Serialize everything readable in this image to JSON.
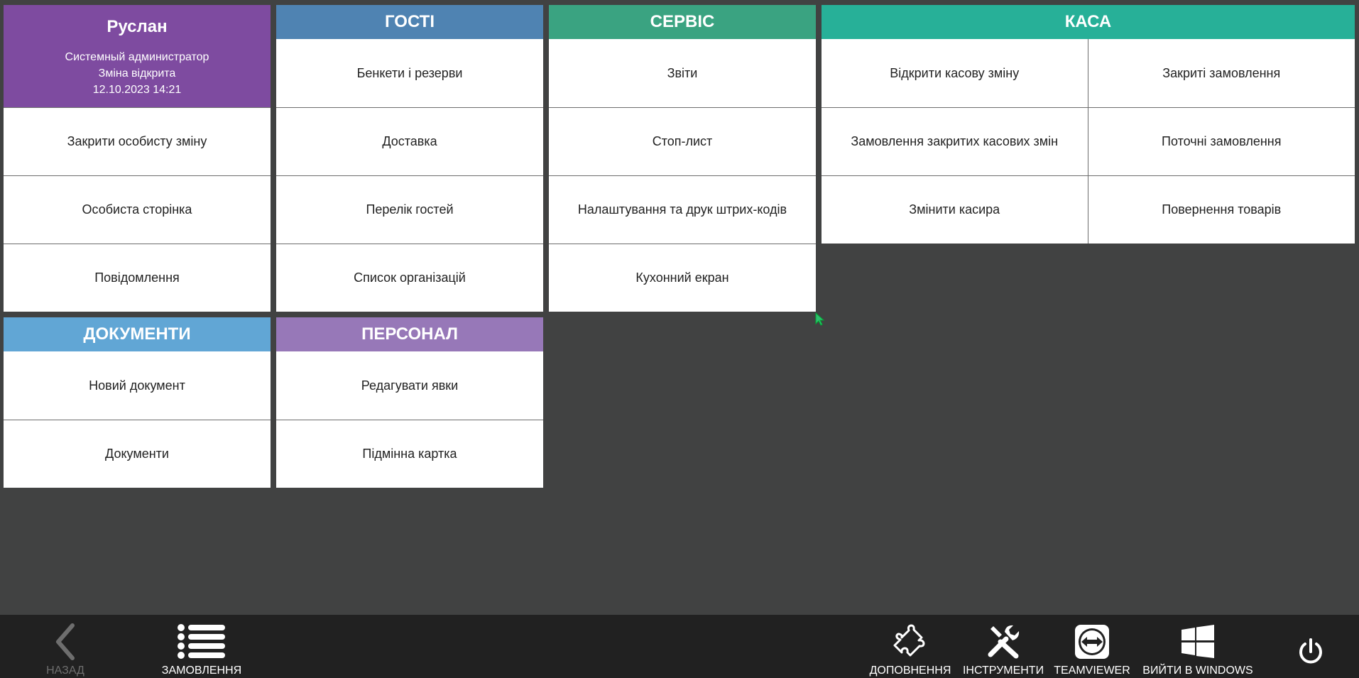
{
  "colors": {
    "background": "#414242",
    "user": "#7e4ba0",
    "guests": "#4f83b2",
    "service": "#3aa381",
    "cash": "#27b098",
    "documents": "#61a6d5",
    "staff": "#9778b8",
    "toolbar": "#212121"
  },
  "user": {
    "name": "Руслан",
    "role": "Системный администратор",
    "shift_status": "Зміна відкрита",
    "datetime": "12.10.2023 14:21",
    "items": [
      "Закрити особисту зміну",
      "Особиста сторінка",
      "Повідомлення"
    ]
  },
  "guests": {
    "title": "ГОСТІ",
    "items": [
      "Бенкети і резерви",
      "Доставка",
      "Перелік гостей",
      "Список організацій"
    ]
  },
  "service": {
    "title": "СЕРВІС",
    "items": [
      "Звіти",
      "Стоп-лист",
      "Налаштування та друк штрих-кодів",
      "Кухонний екран"
    ]
  },
  "cash": {
    "title": "КАСА",
    "items": [
      "Відкрити касову зміну",
      "Закриті замовлення",
      "Замовлення закритих касових змін",
      "Поточні замовлення",
      "Змінити касира",
      "Повернення товарів"
    ]
  },
  "documents": {
    "title": "ДОКУМЕНТИ",
    "items": [
      "Новий документ",
      "Документи"
    ]
  },
  "staff": {
    "title": "ПЕРСОНАЛ",
    "items": [
      "Редагувати явки",
      "Підмінна картка"
    ]
  },
  "toolbar": {
    "back": {
      "label": "НАЗАД",
      "icon": "chevron-left-icon",
      "enabled": false
    },
    "orders": {
      "label": "ЗАМОВЛЕННЯ",
      "icon": "list-icon"
    },
    "addons": {
      "label": "ДОПОВНЕННЯ",
      "icon": "puzzle-icon"
    },
    "tools": {
      "label": "ІНСТРУМЕНТИ",
      "icon": "tools-icon"
    },
    "teamviewer": {
      "label": "TEAMVIEWER",
      "icon": "teamviewer-icon"
    },
    "exit_windows": {
      "label": "ВИЙТИ В WINDOWS",
      "icon": "windows-icon"
    },
    "power": {
      "icon": "power-icon"
    }
  }
}
